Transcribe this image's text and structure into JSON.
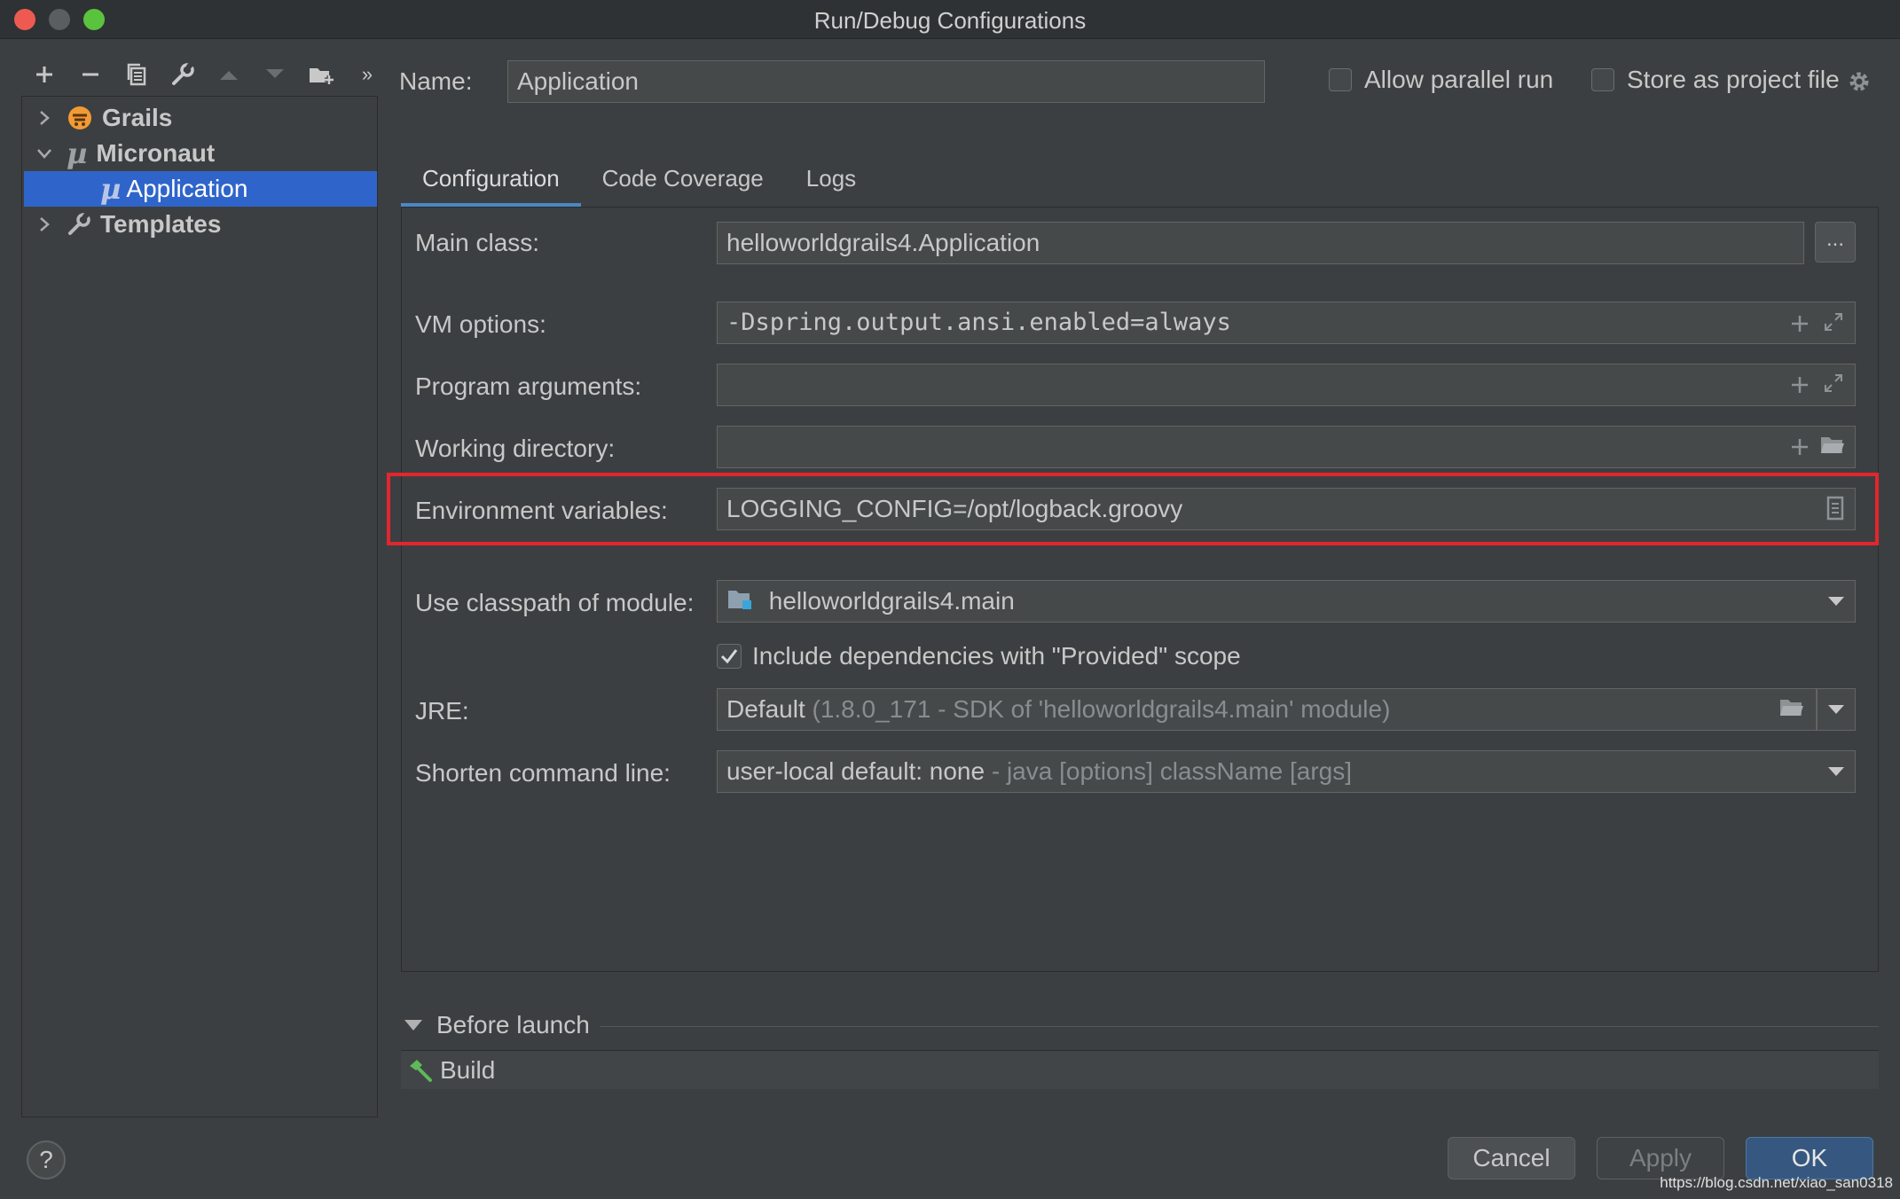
{
  "window": {
    "title": "Run/Debug Configurations"
  },
  "toolbar": {
    "items": [
      {
        "name": "add",
        "icon": "plus-icon"
      },
      {
        "name": "remove",
        "icon": "minus-icon"
      },
      {
        "name": "copy",
        "icon": "copy-icon"
      },
      {
        "name": "edit-defaults",
        "icon": "wrench-icon"
      },
      {
        "name": "move-up",
        "icon": "arrow-up-icon"
      },
      {
        "name": "move-down",
        "icon": "arrow-down-icon"
      },
      {
        "name": "new-folder",
        "icon": "folder-add-icon"
      },
      {
        "name": "more",
        "icon": "double-chevron-icon"
      }
    ]
  },
  "tree": {
    "items": [
      {
        "label": "Grails",
        "icon": "grails-icon",
        "expanded": false
      },
      {
        "label": "Micronaut",
        "icon": "micronaut-icon",
        "expanded": true
      },
      {
        "label": "Application",
        "icon": "micronaut-icon",
        "selected": true
      },
      {
        "label": "Templates",
        "icon": "wrench-icon",
        "expanded": false
      }
    ]
  },
  "header": {
    "name_label": "Name:",
    "name_value": "Application",
    "allow_parallel_label": "Allow parallel run",
    "store_project_label": "Store as project file"
  },
  "tabs": [
    {
      "label": "Configuration",
      "active": true
    },
    {
      "label": "Code Coverage",
      "active": false
    },
    {
      "label": "Logs",
      "active": false
    }
  ],
  "config": {
    "main_class_label": "Main class:",
    "main_class_value": "helloworldgrails4.Application",
    "main_class_browse": "...",
    "vm_options_label": "VM options:",
    "vm_options_value": "-Dspring.output.ansi.enabled=always",
    "program_args_label": "Program arguments:",
    "program_args_value": "",
    "working_dir_label": "Working directory:",
    "working_dir_value": "",
    "env_vars_label": "Environment variables:",
    "env_vars_value": "LOGGING_CONFIG=/opt/logback.groovy",
    "classpath_label": "Use classpath of module:",
    "classpath_value": "helloworldgrails4.main",
    "include_deps_label": "Include dependencies with \"Provided\" scope",
    "include_deps_checked": true,
    "jre_label": "JRE:",
    "jre_value": "Default",
    "jre_detail": "(1.8.0_171 - SDK of 'helloworldgrails4.main' module)",
    "shorten_label": "Shorten command line:",
    "shorten_value": "user-local default: none",
    "shorten_detail": "- java [options] className [args]"
  },
  "before_launch": {
    "label": "Before launch",
    "tasks": [
      {
        "label": "Build",
        "icon": "hammer-icon"
      }
    ]
  },
  "footer": {
    "help": "?",
    "cancel": "Cancel",
    "apply": "Apply",
    "ok": "OK"
  },
  "watermark": "https://blog.csdn.net/xiao_san0318",
  "colors": {
    "background": "#3c3f41",
    "selection": "#2f65ca",
    "accent": "#4a88c7",
    "highlight_box": "#e3262d",
    "ok_button": "#365880"
  }
}
